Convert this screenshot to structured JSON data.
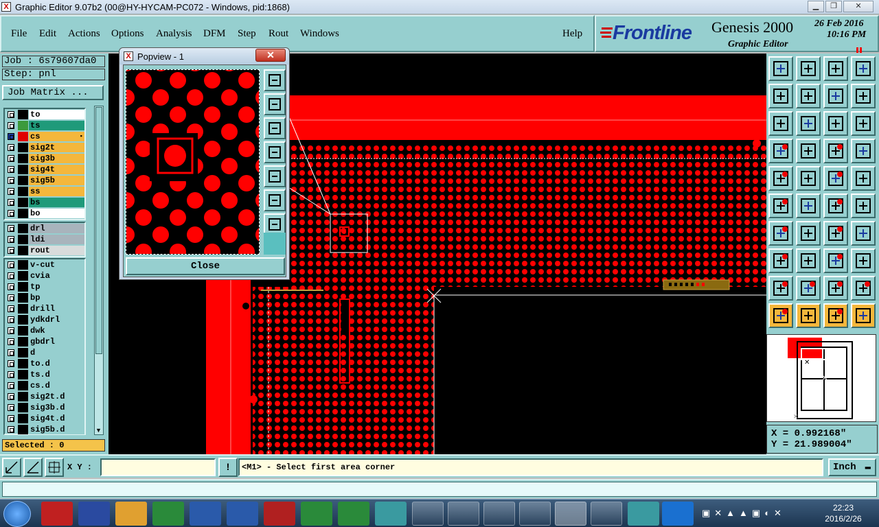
{
  "window": {
    "title": "Graphic Editor 9.07b2 (00@HY-HYCAM-PC072 - Windows, pid:1868)",
    "icon_label": "X"
  },
  "menu": {
    "file": "File",
    "edit": "Edit",
    "actions": "Actions",
    "options": "Options",
    "analysis": "Analysis",
    "dfm": "DFM",
    "step": "Step",
    "rout": "Rout",
    "windows": "Windows",
    "help": "Help"
  },
  "brand": {
    "logo": "Frontline",
    "product": "Genesis 2000",
    "subtitle": "Graphic Editor",
    "date": "26 Feb 2016",
    "time": "10:16 PM"
  },
  "job": {
    "job_line": "Job : 6s79607da0",
    "step_line": "Step: pnl",
    "matrix_button": "Job Matrix ..."
  },
  "layers": {
    "board": [
      {
        "name": "to",
        "color": "#ffffff",
        "swatch": "#000000"
      },
      {
        "name": "ts",
        "color": "#1f9a7a",
        "swatch": "#3c9a3c"
      },
      {
        "name": "cs",
        "color": "#f4b73c",
        "swatch": "#e00000",
        "active": true
      },
      {
        "name": "sig2t",
        "color": "#f4b73c",
        "swatch": "#000000"
      },
      {
        "name": "sig3b",
        "color": "#f4b73c",
        "swatch": "#000000"
      },
      {
        "name": "sig4t",
        "color": "#f4b73c",
        "swatch": "#000000"
      },
      {
        "name": "sig5b",
        "color": "#f4b73c",
        "swatch": "#000000"
      },
      {
        "name": "ss",
        "color": "#f4b73c",
        "swatch": "#000000"
      },
      {
        "name": "bs",
        "color": "#1f9a7a",
        "swatch": "#000000"
      },
      {
        "name": "bo",
        "color": "#ffffff",
        "swatch": "#000000"
      }
    ],
    "drill": [
      {
        "name": "drl",
        "color": "#a8b4bc",
        "swatch": "#000000"
      },
      {
        "name": "ldi",
        "color": "#a8b4bc",
        "swatch": "#000000"
      },
      {
        "name": "rout",
        "color": "#d8dcdc",
        "swatch": "#000000"
      }
    ],
    "misc": [
      {
        "name": "v-cut",
        "color": "#96cfcf",
        "swatch": "#000000"
      },
      {
        "name": "cvia",
        "color": "#96cfcf",
        "swatch": "#000000"
      },
      {
        "name": "tp",
        "color": "#96cfcf",
        "swatch": "#000000"
      },
      {
        "name": "bp",
        "color": "#96cfcf",
        "swatch": "#000000"
      },
      {
        "name": "drill",
        "color": "#96cfcf",
        "swatch": "#000000"
      },
      {
        "name": "ydkdrl",
        "color": "#96cfcf",
        "swatch": "#000000"
      },
      {
        "name": "dwk",
        "color": "#96cfcf",
        "swatch": "#000000"
      },
      {
        "name": "gbdrl",
        "color": "#96cfcf",
        "swatch": "#000000"
      },
      {
        "name": "d",
        "color": "#96cfcf",
        "swatch": "#000000"
      },
      {
        "name": "to.d",
        "color": "#96cfcf",
        "swatch": "#000000"
      },
      {
        "name": "ts.d",
        "color": "#96cfcf",
        "swatch": "#000000"
      },
      {
        "name": "cs.d",
        "color": "#96cfcf",
        "swatch": "#000000"
      },
      {
        "name": "sig2t.d",
        "color": "#96cfcf",
        "swatch": "#000000"
      },
      {
        "name": "sig3b.d",
        "color": "#96cfcf",
        "swatch": "#000000"
      },
      {
        "name": "sig4t.d",
        "color": "#96cfcf",
        "swatch": "#000000"
      },
      {
        "name": "sig5b.d",
        "color": "#96cfcf",
        "swatch": "#000000"
      }
    ]
  },
  "selected": "Selected : 0",
  "popview": {
    "title": "Popview - 1",
    "close_label": "Close"
  },
  "coords": {
    "x": "X = 0.992168\"",
    "y": "Y = 21.989004\""
  },
  "status": {
    "xy_label": "X Y :",
    "xy_value": "",
    "prompt": "<M1> - Select first area corner",
    "unit": "Inch",
    "excl": "!"
  },
  "taskbar": {
    "time": "22:23",
    "date": "2016/2/26"
  },
  "colors": {
    "panel": "#96cfcf",
    "copper": "#ff0000",
    "active_layer": "#f4b73c"
  }
}
